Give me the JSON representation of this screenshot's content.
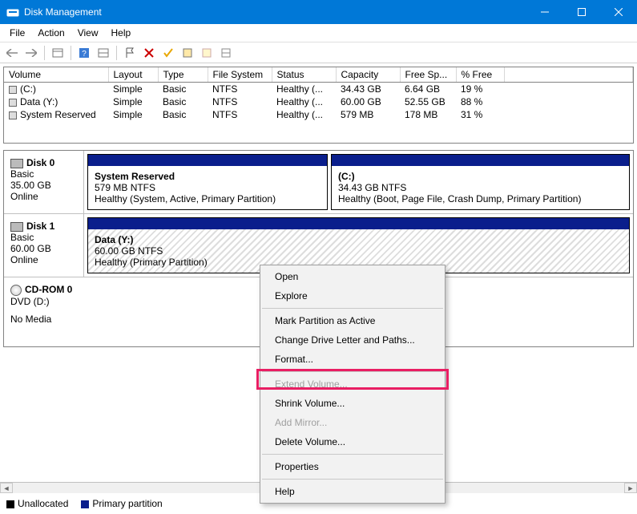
{
  "window": {
    "title": "Disk Management"
  },
  "menu": [
    "File",
    "Action",
    "View",
    "Help"
  ],
  "columns": [
    "Volume",
    "Layout",
    "Type",
    "File System",
    "Status",
    "Capacity",
    "Free Sp...",
    "% Free"
  ],
  "volumes": [
    {
      "name": "(C:)",
      "layout": "Simple",
      "type": "Basic",
      "fs": "NTFS",
      "status": "Healthy (...",
      "capacity": "34.43 GB",
      "free": "6.64 GB",
      "pct": "19 %"
    },
    {
      "name": "Data (Y:)",
      "layout": "Simple",
      "type": "Basic",
      "fs": "NTFS",
      "status": "Healthy (...",
      "capacity": "60.00 GB",
      "free": "52.55 GB",
      "pct": "88 %"
    },
    {
      "name": "System Reserved",
      "layout": "Simple",
      "type": "Basic",
      "fs": "NTFS",
      "status": "Healthy (...",
      "capacity": "579 MB",
      "free": "178 MB",
      "pct": "31 %"
    }
  ],
  "disks": {
    "disk0": {
      "name": "Disk 0",
      "type": "Basic",
      "size": "35.00 GB",
      "state": "Online",
      "parts": [
        {
          "title": "System Reserved",
          "sub": "579 MB NTFS",
          "desc": "Healthy (System, Active, Primary Partition)"
        },
        {
          "title": "(C:)",
          "sub": "34.43 GB NTFS",
          "desc": "Healthy (Boot, Page File, Crash Dump, Primary Partition)"
        }
      ]
    },
    "disk1": {
      "name": "Disk 1",
      "type": "Basic",
      "size": "60.00 GB",
      "state": "Online",
      "parts": [
        {
          "title": "Data  (Y:)",
          "sub": "60.00 GB NTFS",
          "desc": "Healthy (Primary Partition)"
        }
      ]
    },
    "cdrom": {
      "name": "CD-ROM 0",
      "sub": "DVD (D:)",
      "state": "No Media"
    }
  },
  "legend": {
    "unallocated": "Unallocated",
    "primary": "Primary partition"
  },
  "context_menu": [
    {
      "label": "Open",
      "enabled": true
    },
    {
      "label": "Explore",
      "enabled": true
    },
    {
      "sep": true
    },
    {
      "label": "Mark Partition as Active",
      "enabled": true
    },
    {
      "label": "Change Drive Letter and Paths...",
      "enabled": true
    },
    {
      "label": "Format...",
      "enabled": true
    },
    {
      "sep": true
    },
    {
      "label": "Extend Volume...",
      "enabled": false
    },
    {
      "label": "Shrink Volume...",
      "enabled": true,
      "highlighted": true
    },
    {
      "label": "Add Mirror...",
      "enabled": false
    },
    {
      "label": "Delete Volume...",
      "enabled": true
    },
    {
      "sep": true
    },
    {
      "label": "Properties",
      "enabled": true
    },
    {
      "sep": true
    },
    {
      "label": "Help",
      "enabled": true
    }
  ]
}
